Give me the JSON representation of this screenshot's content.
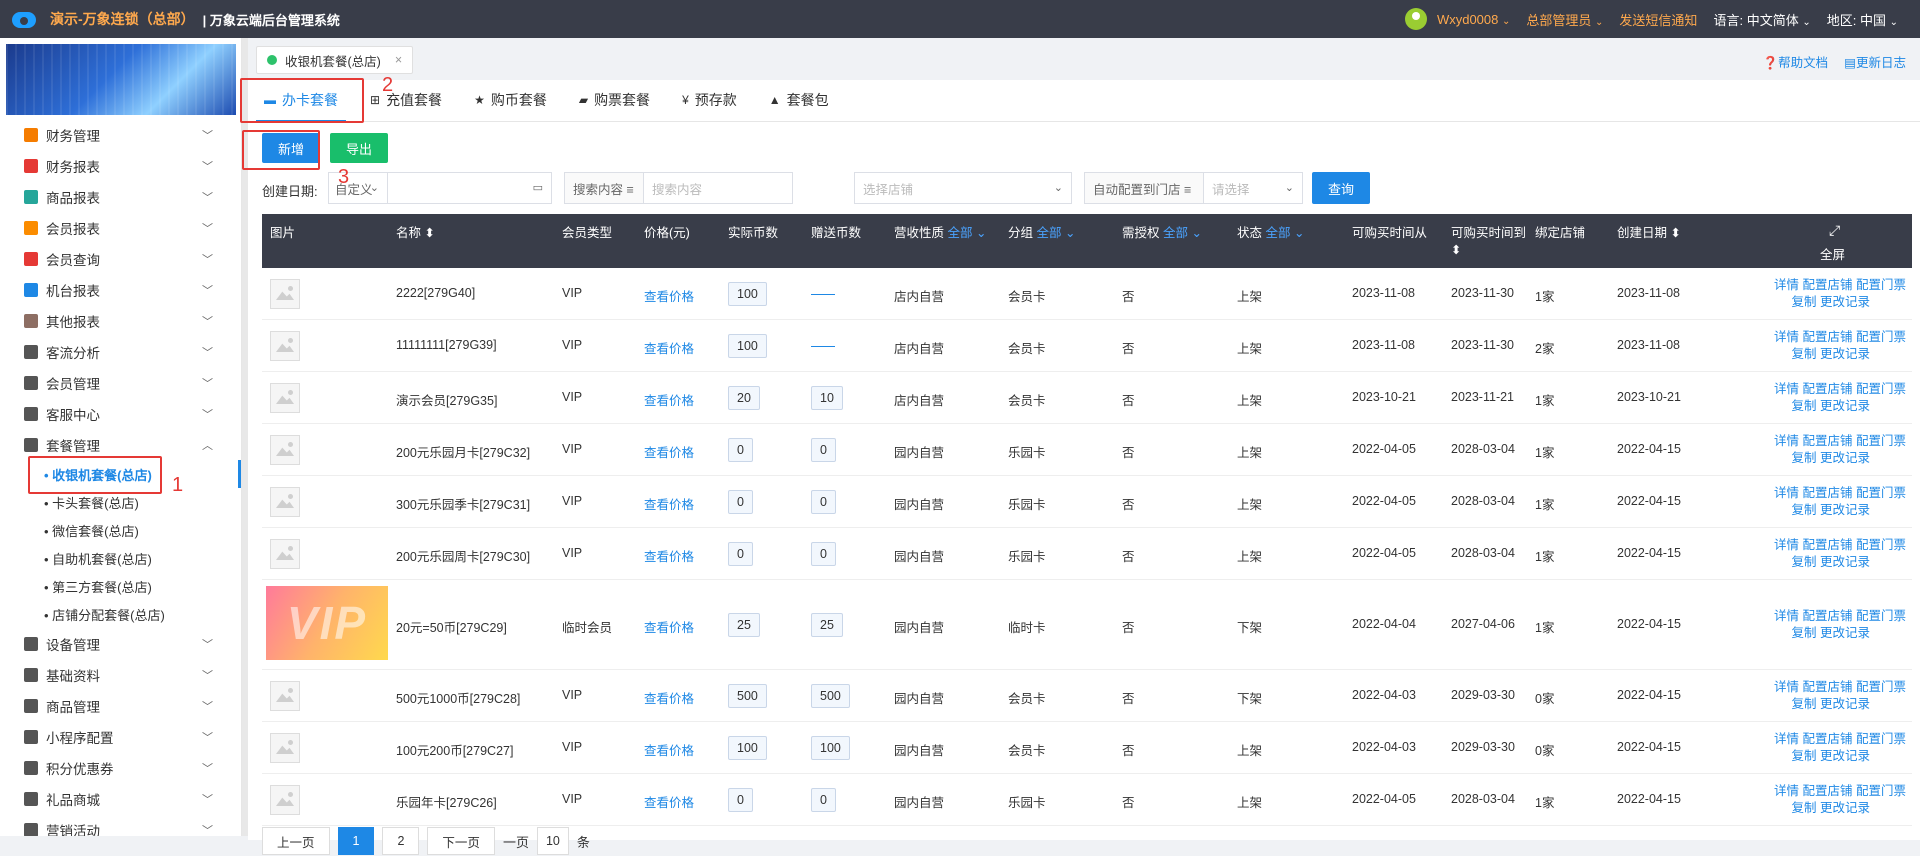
{
  "header": {
    "brand": "演示-万象连锁（总部）",
    "system": "| 万象云端后台管理系统",
    "user": "Wxyd0008",
    "role": "总部管理员",
    "sms": "发送短信通知",
    "lang_label": "语言:",
    "lang": "中文简体",
    "region_label": "地区:",
    "region": "中国"
  },
  "sidebar": {
    "items": [
      {
        "label": "财务管理",
        "color": "#f57c00"
      },
      {
        "label": "财务报表",
        "color": "#e53935"
      },
      {
        "label": "商品报表",
        "color": "#26a69a"
      },
      {
        "label": "会员报表",
        "color": "#fb8c00"
      },
      {
        "label": "会员查询",
        "color": "#e53935"
      },
      {
        "label": "机台报表",
        "color": "#1e88e5"
      },
      {
        "label": "其他报表",
        "color": "#8d6e63"
      },
      {
        "label": "客流分析",
        "color": "#555555"
      },
      {
        "label": "会员管理",
        "color": "#555555"
      },
      {
        "label": "客服中心",
        "color": "#555555"
      },
      {
        "label": "套餐管理",
        "color": "#555555"
      }
    ],
    "subitems": [
      "• 收银机套餐(总店)",
      "• 卡头套餐(总店)",
      "• 微信套餐(总店)",
      "• 自助机套餐(总店)",
      "• 第三方套餐(总店)",
      "• 店铺分配套餐(总店)"
    ],
    "items2": [
      {
        "label": "设备管理"
      },
      {
        "label": "基础资料"
      },
      {
        "label": "商品管理"
      },
      {
        "label": "小程序配置"
      },
      {
        "label": "积分优惠券"
      },
      {
        "label": "礼品商城"
      },
      {
        "label": "营销活动"
      }
    ]
  },
  "pagetab": {
    "label": "收银机套餐(总店)",
    "close": "×"
  },
  "toplinks": {
    "help": "❓帮助文档",
    "log": "▤更新日志"
  },
  "tabs": [
    "办卡套餐",
    "充值套餐",
    "购币套餐",
    "购票套餐",
    "预存款",
    "套餐包"
  ],
  "tab_icons": [
    "▬",
    "⊞",
    "★",
    "▰",
    "¥",
    "▲"
  ],
  "annotations": [
    "1",
    "2",
    "3"
  ],
  "buttons": {
    "add": "新增",
    "export": "导出",
    "query": "查询"
  },
  "filters": {
    "date_label": "创建日期:",
    "date_mode": "自定义",
    "search_mode": "搜索内容 ≡",
    "search_placeholder": "搜索内容",
    "store_placeholder": "选择店铺",
    "auto_label": "自动配置到门店 ≡",
    "auto_placeholder": "请选择"
  },
  "table": {
    "headers": {
      "img": "图片",
      "name": "名称 ⬍",
      "type": "会员类型",
      "price": "价格(元)",
      "coins": "实际币数",
      "gift": "赠送币数",
      "nature": "营收性质",
      "group": "分组",
      "auth": "需授权",
      "status": "状态",
      "from": "可购买时间从",
      "to": "可购买时间到",
      "bind": "绑定店铺",
      "created": "创建日期 ⬍",
      "all": "全部 ⌄",
      "full": "全屏"
    },
    "rows": [
      {
        "name": "2222[279G40]",
        "type": "VIP",
        "price": "查看价格",
        "coins": "100",
        "gift": "",
        "nature": "店内自营",
        "group": "会员卡",
        "auth": "否",
        "status": "上架",
        "from": "2023-11-08",
        "to": "2023-11-30",
        "bind": "1家",
        "created": "2023-11-08"
      },
      {
        "name": "11111111[279G39]",
        "type": "VIP",
        "price": "查看价格",
        "coins": "100",
        "gift": "",
        "nature": "店内自营",
        "group": "会员卡",
        "auth": "否",
        "status": "上架",
        "from": "2023-11-08",
        "to": "2023-11-30",
        "bind": "2家",
        "created": "2023-11-08"
      },
      {
        "name": "演示会员[279G35]",
        "type": "VIP",
        "price": "查看价格",
        "coins": "20",
        "gift": "10",
        "nature": "店内自营",
        "group": "会员卡",
        "auth": "否",
        "status": "上架",
        "from": "2023-10-21",
        "to": "2023-11-21",
        "bind": "1家",
        "created": "2023-10-21"
      },
      {
        "name": "200元乐园月卡[279C32]",
        "type": "VIP",
        "price": "查看价格",
        "coins": "0",
        "gift": "0",
        "nature": "园内自营",
        "group": "乐园卡",
        "auth": "否",
        "status": "上架",
        "from": "2022-04-05",
        "to": "2028-03-04",
        "bind": "1家",
        "created": "2022-04-15"
      },
      {
        "name": "300元乐园季卡[279C31]",
        "type": "VIP",
        "price": "查看价格",
        "coins": "0",
        "gift": "0",
        "nature": "园内自营",
        "group": "乐园卡",
        "auth": "否",
        "status": "上架",
        "from": "2022-04-05",
        "to": "2028-03-04",
        "bind": "1家",
        "created": "2022-04-15"
      },
      {
        "name": "200元乐园周卡[279C30]",
        "type": "VIP",
        "price": "查看价格",
        "coins": "0",
        "gift": "0",
        "nature": "园内自营",
        "group": "乐园卡",
        "auth": "否",
        "status": "上架",
        "from": "2022-04-05",
        "to": "2028-03-04",
        "bind": "1家",
        "created": "2022-04-15"
      },
      {
        "name": "20元=50币[279C29]",
        "type": "临时会员",
        "price": "查看价格",
        "coins": "25",
        "gift": "25",
        "nature": "园内自营",
        "group": "临时卡",
        "auth": "否",
        "status": "下架",
        "from": "2022-04-04",
        "to": "2027-04-06",
        "bind": "1家",
        "created": "2022-04-15",
        "vip": "VIP"
      },
      {
        "name": "500元1000币[279C28]",
        "type": "VIP",
        "price": "查看价格",
        "coins": "500",
        "gift": "500",
        "nature": "园内自营",
        "group": "会员卡",
        "auth": "否",
        "status": "下架",
        "from": "2022-04-03",
        "to": "2029-03-30",
        "bind": "0家",
        "created": "2022-04-15"
      },
      {
        "name": "100元200币[279C27]",
        "type": "VIP",
        "price": "查看价格",
        "coins": "100",
        "gift": "100",
        "nature": "园内自营",
        "group": "会员卡",
        "auth": "否",
        "status": "上架",
        "from": "2022-04-03",
        "to": "2029-03-30",
        "bind": "0家",
        "created": "2022-04-15"
      },
      {
        "name": "乐园年卡[279C26]",
        "type": "VIP",
        "price": "查看价格",
        "coins": "0",
        "gift": "0",
        "nature": "园内自营",
        "group": "乐园卡",
        "auth": "否",
        "status": "上架",
        "from": "2022-04-05",
        "to": "2028-03-04",
        "bind": "1家",
        "created": "2022-04-15"
      }
    ],
    "ops_line1": "详情 配置店铺 配置门票",
    "ops_line2": "复制 更改记录"
  },
  "pager": {
    "prev": "上一页",
    "p1": "1",
    "p2": "2",
    "next": "下一页",
    "size_pre": "一页",
    "size": "10",
    "size_post": "条"
  }
}
